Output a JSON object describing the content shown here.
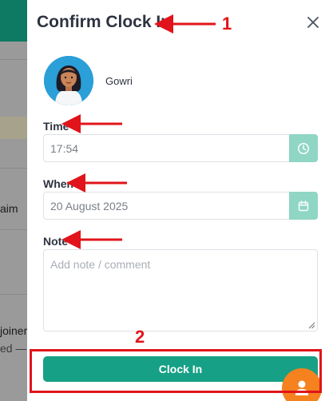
{
  "background": {
    "fragment_1": "aim",
    "fragment_2": "joiner",
    "fragment_3": "ed —"
  },
  "dialog": {
    "title": "Confirm Clock In",
    "close_icon": "close-icon"
  },
  "user": {
    "name": "Gowri",
    "avatar_icon": "user-avatar"
  },
  "fields": {
    "time": {
      "label": "Time",
      "value": "17:54",
      "icon": "clock-icon"
    },
    "when": {
      "label": "When",
      "value": "20 August 2025",
      "icon": "calendar-icon"
    },
    "note": {
      "label": "Note",
      "placeholder": "Add note / comment"
    }
  },
  "actions": {
    "clock_in_label": "Clock In"
  },
  "annotations": {
    "label_1": "1",
    "label_2": "2"
  },
  "colors": {
    "accent": "#16a085",
    "addon": "#8fd6c4",
    "annotation": "#e0141a",
    "fab": "#f5821f"
  }
}
